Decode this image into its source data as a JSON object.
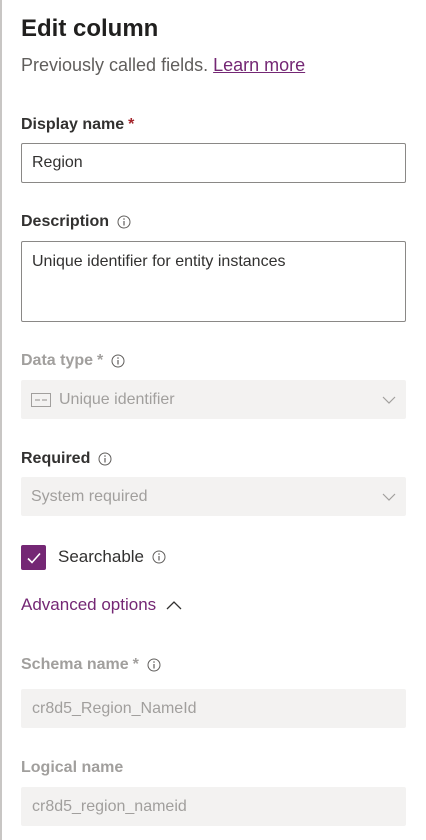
{
  "panel": {
    "title": "Edit column",
    "subtitle": "Previously called fields.",
    "learn_more": "Learn more"
  },
  "display_name": {
    "label": "Display name",
    "required_mark": "*",
    "value": "Region"
  },
  "description": {
    "label": "Description",
    "value": "Unique identifier for entity instances"
  },
  "data_type": {
    "label": "Data type",
    "required_mark": "*",
    "value": "Unique identifier",
    "icon": "unique-identifier-icon"
  },
  "required": {
    "label": "Required",
    "value": "System required"
  },
  "searchable": {
    "label": "Searchable",
    "checked": true
  },
  "advanced": {
    "label": "Advanced options"
  },
  "schema_name": {
    "label": "Schema name",
    "required_mark": "*",
    "value": "cr8d5_Region_NameId"
  },
  "logical_name": {
    "label": "Logical name",
    "value": "cr8d5_region_nameid"
  },
  "colors": {
    "accent": "#742774",
    "required": "#a4262c",
    "disabled_bg": "#f3f2f1",
    "disabled_text": "#a19f9d"
  }
}
